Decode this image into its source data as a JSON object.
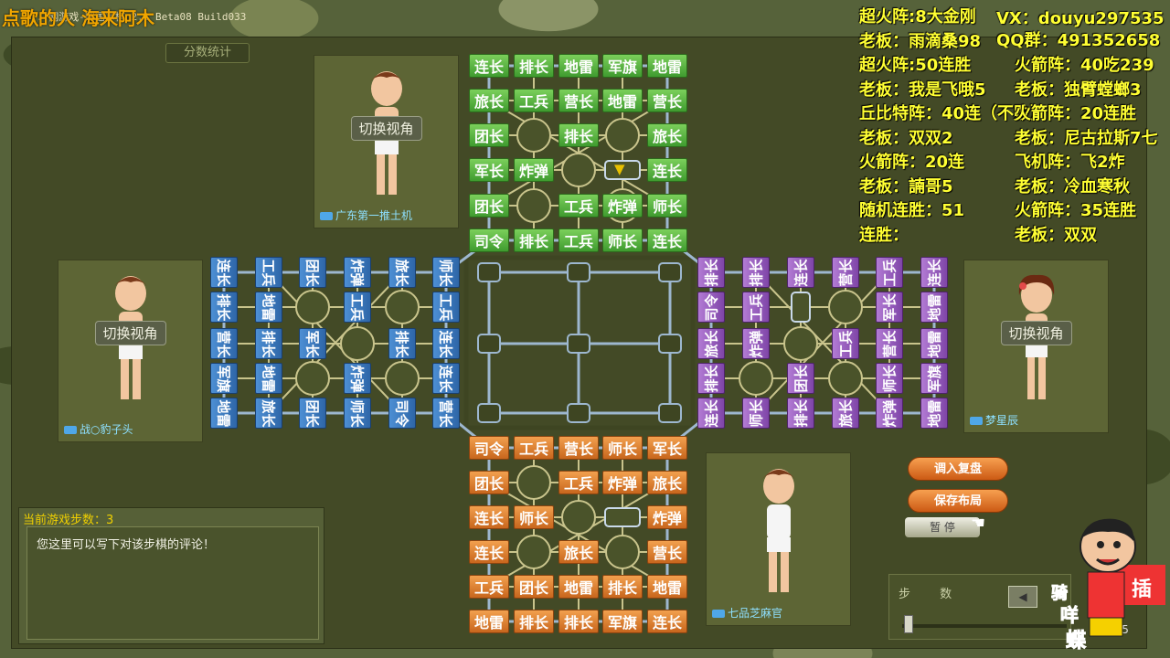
{
  "window": {
    "title_text": "..网游戏-四国军棋 2.1 Beta08 Build033",
    "title_overlay": "点歌的人  海来阿木"
  },
  "stats_tab": "分数统计",
  "players": {
    "top": {
      "name": "广东第一推土机",
      "view_button": "切换视角"
    },
    "left": {
      "name": "战○豹子头",
      "view_button": "切换视角"
    },
    "right": {
      "name": "梦星辰",
      "view_button": "切换视角"
    },
    "bottom": {
      "name": "七品芝麻官"
    }
  },
  "board": {
    "green_top": [
      [
        "连长",
        "排长",
        "地雷",
        "军旗",
        "地雷"
      ],
      [
        "旅长",
        "工兵",
        "营长",
        "地雷",
        "营长"
      ],
      [
        "团长",
        "",
        "排长",
        "",
        "旅长"
      ],
      [
        "军长",
        "炸弹",
        "",
        "",
        "连长"
      ],
      [
        "团长",
        "",
        "工兵",
        "炸弹",
        "师长"
      ],
      [
        "司令",
        "排长",
        "工兵",
        "师长",
        "连长"
      ]
    ],
    "orange_bottom": [
      [
        "司令",
        "工兵",
        "营长",
        "师长",
        "军长"
      ],
      [
        "团长",
        "",
        "工兵",
        "炸弹",
        "旅长"
      ],
      [
        "连长",
        "师长",
        "",
        "",
        "炸弹"
      ],
      [
        "连长",
        "",
        "旅长",
        "",
        "营长"
      ],
      [
        "工兵",
        "团长",
        "地雷",
        "排长",
        "地雷"
      ],
      [
        "地雷",
        "排长",
        "排长",
        "军旗",
        "连长"
      ]
    ],
    "blue_left": [
      [
        "连长",
        "排长",
        "营长",
        "军旗",
        "地雷"
      ],
      [
        "工兵",
        "地雷",
        "排长",
        "地雷",
        "旅长"
      ],
      [
        "团长",
        "",
        "军长",
        "",
        "团长"
      ],
      [
        "炸弹",
        "工兵",
        "",
        "炸弹",
        "师长"
      ],
      [
        "旅长",
        "",
        "排长",
        "",
        "司令"
      ],
      [
        "师长",
        "工兵",
        "连长",
        "连长",
        "营长"
      ]
    ],
    "purple_right": [
      [
        "排长",
        "司令",
        "旅长",
        "排长",
        "连长"
      ],
      [
        "排长",
        "工兵",
        "炸弹",
        "",
        "师长"
      ],
      [
        "连长",
        "",
        "",
        "团长",
        "排长"
      ],
      [
        "营长",
        "",
        "工兵",
        "",
        "旅长"
      ],
      [
        "工兵",
        "军长",
        "营长",
        "师长",
        "炸弹"
      ],
      [
        "连长",
        "地雷",
        "地雷",
        "军旗",
        "地雷"
      ]
    ]
  },
  "comment": {
    "steps_label": "当前游戏步数：3",
    "placeholder": "您这里可以写下对该步棋的评论！"
  },
  "buttons": {
    "load_replay": "调入复盘",
    "save_layout": "保存布局",
    "pause": "暂 停"
  },
  "step_panel": {
    "label": "步 数",
    "value": "565"
  },
  "stream_overlay": {
    "vx": "VX：douyu297535",
    "qq": "QQ群：491352658",
    "col1": [
      "超火阵:8大金刚",
      "老板：雨滴桑98",
      "超火阵:50连胜",
      "老板：我是飞哦5",
      "丘比特阵：40连（不败）",
      "老板：双双2",
      "火箭阵：20连",
      "老板：諵哥5",
      "随机连胜：51",
      "连胜："
    ],
    "col2": [
      "火箭阵：40吃239",
      "老板：独臂螳螂3",
      "火箭阵：20连胜",
      "老板：尼古拉斯7七",
      "飞机阵：飞2炸",
      "老板：冷血寒秋",
      "火箭阵：35连胜",
      "老板：双双"
    ]
  }
}
